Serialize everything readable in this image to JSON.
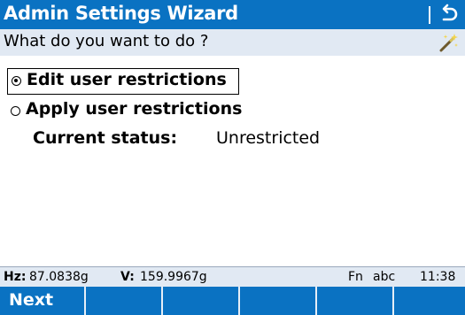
{
  "window": {
    "title": "Admin Settings Wizard",
    "back_icon": "return-arrow-icon",
    "title_color": "#0a72c2"
  },
  "subheader": {
    "question": "What do you want to do ?",
    "icon": "magic-wand-icon",
    "background": "#e1e9f3"
  },
  "options": [
    {
      "label": "Edit user restrictions",
      "selected": true,
      "focused": true
    },
    {
      "label": "Apply user restrictions",
      "selected": false,
      "focused": false
    }
  ],
  "status": {
    "label": "Current status:",
    "value": "Unrestricted"
  },
  "statusbar": {
    "hz_label": "Hz:",
    "hz_value": "87.0838g",
    "v_label": "V:",
    "v_value": "159.9967g",
    "fn": "Fn",
    "input_mode": "abc",
    "time": "11:38"
  },
  "softkeys": [
    {
      "label": "Next"
    },
    {
      "label": ""
    },
    {
      "label": ""
    },
    {
      "label": ""
    },
    {
      "label": ""
    },
    {
      "label": ""
    }
  ]
}
